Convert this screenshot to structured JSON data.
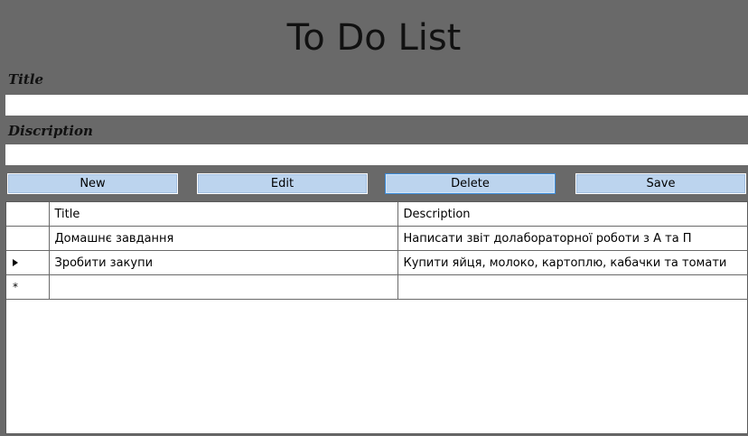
{
  "app": {
    "title": "To Do List"
  },
  "form": {
    "title_label": "Title",
    "title_value": "",
    "description_label": "Discription",
    "description_value": ""
  },
  "toolbar": {
    "new_label": "New",
    "edit_label": "Edit",
    "delete_label": "Delete",
    "save_label": "Save"
  },
  "grid": {
    "columns": [
      "Title",
      "Description"
    ],
    "rows": [
      {
        "title": "Домашнє завдання",
        "description": "Написати звіт долабораторної роботи з А та П",
        "marker": ""
      },
      {
        "title": "Зробити закупи",
        "description": "Купити яйця, молоко, картоплю, кабачки та томати",
        "marker": "current-row-arrow-icon"
      }
    ],
    "new_row_marker": "new-row-asterisk-icon"
  },
  "colors": {
    "window_background": "#696969",
    "button_background": "#bcd4ee",
    "button_focus_border": "#3a8ad8"
  }
}
